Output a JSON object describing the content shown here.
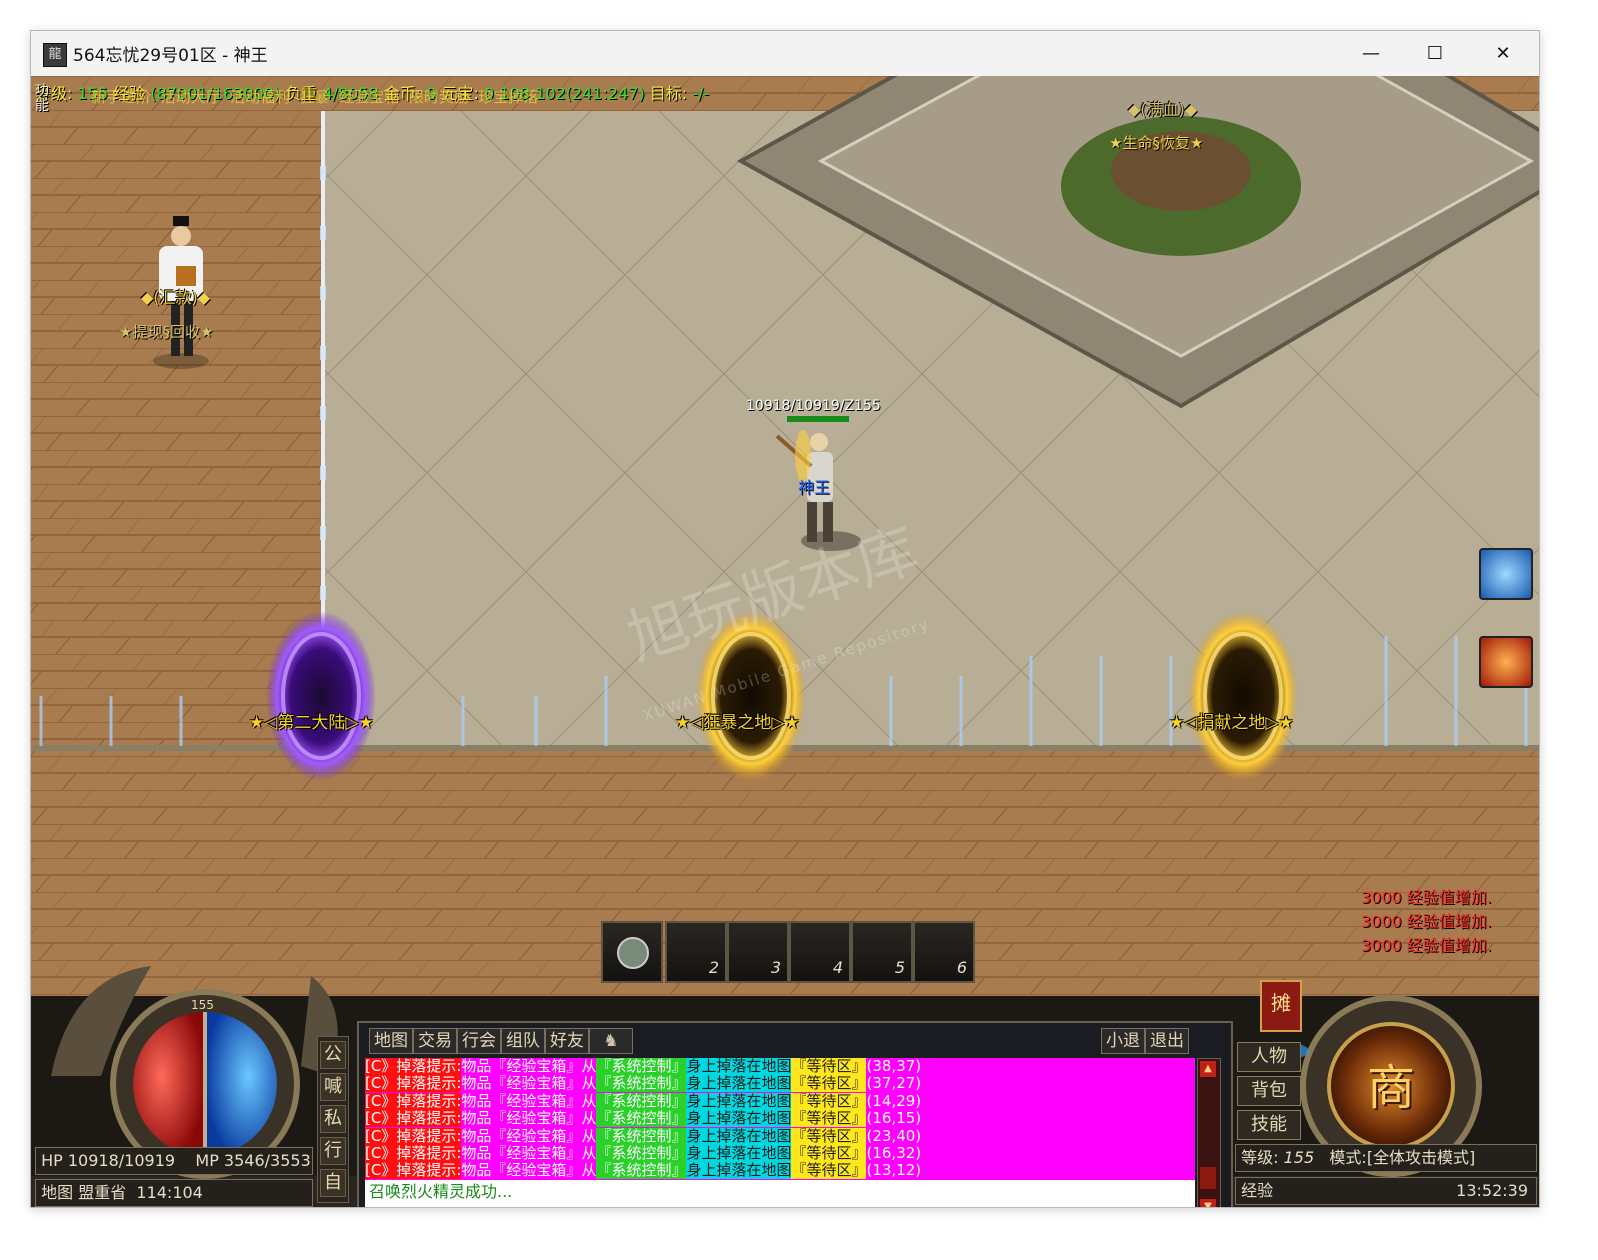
{
  "window": {
    "title": "564忘忧29号01区 - 神王",
    "app_icon": "龍",
    "controls": {
      "minimize": "—",
      "maximize": "☐",
      "close": "✕"
    }
  },
  "top_status": {
    "level_label": "等级:",
    "level_value": "155",
    "exp_label": "经验",
    "exp_value": "(87001/163000)",
    "weight_label": "负重",
    "weight_value": "4/8058",
    "gold_label": "金币:",
    "gold_value": "0",
    "yuanbao_label": "元宝:",
    "yuanbao_value": "0",
    "coords": "108:102(241:247)",
    "target_label": "目标:",
    "target_value": "-/-",
    "overlay_text_1": "新手进阶",
    "overlay_text_2": "活动大厅",
    "overlay_text_3": "活动福利",
    "overlay_text_4": "狂暴",
    "overlay_text_5": "经验宝箱",
    "overlay_text_6": "限时奖励",
    "overlay_text_7": "珍宝掉落",
    "skill_label": "功\n能"
  },
  "npcs": [
    {
      "name": "◆(汇款)◆",
      "sub": "★提现§回收★"
    },
    {
      "name": "◆(满血)◆",
      "sub": "★生命§恢复★"
    }
  ],
  "player": {
    "hp_text": "10918/10919/Z155",
    "name": "神王"
  },
  "portals": [
    {
      "label": "★◁第二大陆▷★",
      "color": "#8a3cff"
    },
    {
      "label": "★◁狂暴之地▷★",
      "color": "#f3b21a"
    },
    {
      "label": "★◁捐献之地▷★",
      "color": "#f3b21a"
    }
  ],
  "watermark": {
    "main": "旭玩版本库",
    "sub": "XUWAN Mobile Game Repository"
  },
  "exp_messages": [
    "3000 经验值增加.",
    "3000 经验值增加.",
    "3000 经验值增加."
  ],
  "skill_buttons": [
    {
      "icon": "ice-blast-skill-icon",
      "color": "#3a8fe0"
    },
    {
      "icon": "fire-slash-skill-icon",
      "color": "#e0401a"
    }
  ],
  "hotbar": {
    "slots": [
      "",
      "2",
      "3",
      "4",
      "5",
      "6"
    ]
  },
  "chat": {
    "tabs": [
      "地图",
      "交易",
      "行会",
      "组队",
      "好友"
    ],
    "right_tabs": [
      "小退",
      "退出"
    ],
    "channels": [
      "公",
      "喊",
      "私",
      "行",
      "自"
    ],
    "messages": [
      {
        "prefix": "[C》掉落提示:",
        "item_label": "物品",
        "item": "『经验宝箱』",
        "from": "从",
        "source": "『系统控制』",
        "mid": "身上掉落在地图",
        "map": "『等待区』",
        "pos": "(38,37)"
      },
      {
        "prefix": "[C》掉落提示:",
        "item_label": "物品",
        "item": "『经验宝箱』",
        "from": "从",
        "source": "『系统控制』",
        "mid": "身上掉落在地图",
        "map": "『等待区』",
        "pos": "(37,27)"
      },
      {
        "prefix": "[C》掉落提示:",
        "item_label": "物品",
        "item": "『经验宝箱』",
        "from": "从",
        "source": "『系统控制』",
        "mid": "身上掉落在地图",
        "map": "『等待区』",
        "pos": "(14,29)"
      },
      {
        "prefix": "[C》掉落提示:",
        "item_label": "物品",
        "item": "『经验宝箱』",
        "from": "从",
        "source": "『系统控制』",
        "mid": "身上掉落在地图",
        "map": "『等待区』",
        "pos": "(16,15)"
      },
      {
        "prefix": "[C》掉落提示:",
        "item_label": "物品",
        "item": "『经验宝箱』",
        "from": "从",
        "source": "『系统控制』",
        "mid": "身上掉落在地图",
        "map": "『等待区』",
        "pos": "(23,40)"
      },
      {
        "prefix": "[C》掉落提示:",
        "item_label": "物品",
        "item": "『经验宝箱』",
        "from": "从",
        "source": "『系统控制』",
        "mid": "身上掉落在地图",
        "map": "『等待区』",
        "pos": "(16,32)"
      },
      {
        "prefix": "[C》掉落提示:",
        "item_label": "物品",
        "item": "『经验宝箱』",
        "from": "从",
        "source": "『系统控制』",
        "mid": "身上掉落在地图",
        "map": "『等待区』",
        "pos": "(13,12)"
      }
    ],
    "system_log": "召唤烈火精灵成功..."
  },
  "hud": {
    "hp": "HP 10918/10919",
    "mp": "MP 3546/3553",
    "map_label": "地图",
    "map_name": "盟重省",
    "map_pos": "114:104",
    "orb_level": "155",
    "right_buttons": [
      "人物",
      "背包",
      "技能"
    ],
    "shop_label": "商",
    "stall_label": "摊",
    "level_label": "等级:",
    "level_value": "155",
    "mode_label": "模式:",
    "mode_value": "[全体攻击模式]",
    "exp_label": "经验",
    "exp_fraction": 0.53,
    "time": "13:52:39"
  }
}
